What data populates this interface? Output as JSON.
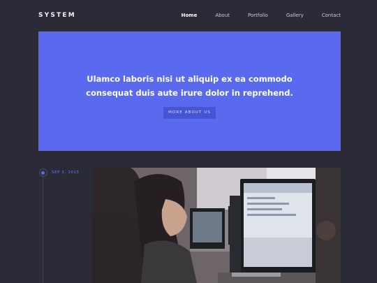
{
  "header": {
    "brand": "SYSTEM",
    "nav": [
      {
        "label": "Home",
        "active": true
      },
      {
        "label": "About",
        "active": false
      },
      {
        "label": "Portfolio",
        "active": false
      },
      {
        "label": "Gallery",
        "active": false
      },
      {
        "label": "Contact",
        "active": false
      }
    ]
  },
  "hero": {
    "heading": "Ulamco laboris nisi ut aliquip ex ea commodo consequat duis aute irure dolor in reprehend.",
    "button_label": "MORE ABOUT US",
    "background_color": "#5a6aef"
  },
  "post": {
    "date": "SEP 3, 2015"
  }
}
